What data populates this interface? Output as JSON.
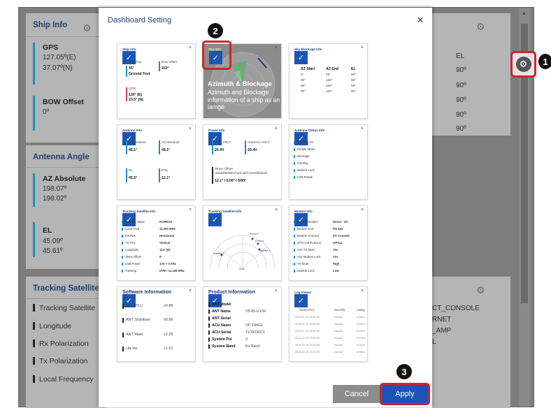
{
  "background": {
    "ship_info": {
      "title": "Ship Info",
      "gps_label": "GPS",
      "gps_lat": "127.05º(E)",
      "gps_lon": "37.07º(N)",
      "bow_label": "BOW Offset",
      "bow_value": "0º"
    },
    "antenna_angle": {
      "title": "Antenna Angle",
      "az_label": "AZ Absolute",
      "az_v1": "198.07º",
      "az_v2": "198.02º",
      "el_label": "EL",
      "el_v1": "45.09º",
      "el_v2": "45.61º"
    },
    "tracking": {
      "title": "Tracking Satellite",
      "items": [
        "Tracking Satellite",
        "Longitude",
        "Rx Polarization",
        "Tx Polarization",
        "Local Frequency"
      ]
    },
    "right_el": {
      "header": "EL",
      "values": [
        "90º",
        "90º",
        "90º",
        "90º",
        "90º"
      ]
    },
    "right_partial": [
      "CT_CONSOLE",
      "RNET",
      "_AMP",
      "L"
    ]
  },
  "callouts": {
    "c1": "1",
    "c2": "2",
    "c3": "3"
  },
  "modal": {
    "title": "Dashboard Setting",
    "close": "×",
    "cards": {
      "ship_info": {
        "title": "Ship Info",
        "items": [
          {
            "label": "Heading",
            "value": "45°",
            "sub": "Ground Test"
          },
          {
            "label": "Bow offset",
            "value": "163°"
          },
          {
            "label": "GPS",
            "value1": "120° (E)",
            "value2": "23.5° (N)"
          }
        ]
      },
      "azimuth": {
        "title": "Sky Info",
        "overlay_title": "Azimuth & Blockage",
        "overlay_text": "Azimuth and Blockage information of a ship as an iamge"
      },
      "blockage": {
        "title": "Sky Blockage Info",
        "headers": [
          "AZ Start",
          "AZ End",
          "EL"
        ],
        "rows": [
          [
            "0°",
            "20°",
            "90°"
          ],
          [
            "90°",
            "100°",
            "90°"
          ],
          [
            "90°",
            "100°",
            "90°"
          ],
          [
            "90°",
            "100°",
            "90°"
          ]
        ]
      },
      "antenna": {
        "title": "Antenna Info",
        "items": [
          {
            "label": "AZ Relative",
            "value": "45.1°"
          },
          {
            "label": "AZ Absolute",
            "value": "45.1°"
          },
          {
            "label": "EL",
            "value": "45.5°"
          },
          {
            "label": "POL",
            "value": "12.1°"
          }
        ]
      },
      "power": {
        "title": "Power Info",
        "items": [
          {
            "label": "ACU VOLT",
            "value": "26.9V"
          },
          {
            "label": "Antenna VOLT",
            "value": "20.4V"
          },
          {
            "label": "Skew Offset (Satellite/Mechanical/Consolidated)",
            "value": "12.1° / 0.00° / 0/00°"
          }
        ]
      },
      "status": {
        "title": "Antenna Status Info",
        "items": [
          "Tracking On",
          "Enable Mode",
          "Blockage",
          "Pointing",
          "Modem Lock",
          "LNB Rotate"
        ]
      },
      "tracking_sat": {
        "title": "Tracking Satellite Info",
        "rows": [
          [
            "Satellite Name",
            "KOREA5"
          ],
          [
            "Local Freq",
            "11,300 MHz"
          ],
          [
            "RX POL",
            "Horizontal"
          ],
          [
            "TX POL",
            "Vertical"
          ],
          [
            "Longitude",
            "113° (E)"
          ],
          [
            "Skew Offset",
            "0°"
          ],
          [
            "LNB Power",
            "13V + 0 kHz"
          ],
          [
            "Tracking",
            "DVB / 12,166 MHz"
          ]
        ]
      },
      "tracking_chart": {
        "title": "Tracking Satellite Info",
        "labels": [
          "Korea 5",
          "Korea 6",
          "Satellite A",
          "Satellite B"
        ],
        "center": "Ship"
      },
      "modem": {
        "title": "Modem Info",
        "rows": [
          [
            "Current Modem",
            "Direct - I/O"
          ],
          [
            "Modem Port",
            "RS 232"
          ],
          [
            "Modem Protocol",
            "I/O Console"
          ],
          [
            "GPS Out Protocol",
            "GPGLL"
          ],
          [
            "Use TX Mute",
            "Yes"
          ],
          [
            "Use Modem Lock",
            "Yes"
          ],
          [
            "TX Mute",
            "High"
          ],
          [
            "Modem Lock",
            "Low"
          ]
        ]
      },
      "software": {
        "title": "Software Information",
        "rows": [
          [
            "ACU PLU",
            "v0.89"
          ],
          [
            "ANT Stabilizer",
            "v0.86"
          ],
          [
            "ANT Main",
            "v2.29"
          ],
          [
            "Lib Ver",
            "v1.01"
          ]
        ]
      },
      "product": {
        "title": "Product Information",
        "rows": [
          [
            "ANT Model",
            ""
          ],
          [
            "ANT Name",
            "V5-85-U1/W"
          ],
          [
            "ANT Serial",
            ""
          ],
          [
            "ACU Name",
            "VP-T84G1"
          ],
          [
            "ACU Serial",
            "1V15030C1"
          ],
          [
            "System Pol",
            "3"
          ],
          [
            "System Band",
            "Ku Band"
          ]
        ]
      },
      "log": {
        "title": "Log Viewer",
        "headers": [
          "Time(UTC)",
          "Severity",
          "Categ"
        ],
        "rows": [
          [
            "2018-01-19 00:02:00",
            "Normal",
            "Antenn"
          ],
          [
            "2018-01-19 00:02:00",
            "Normal",
            "Antenn"
          ],
          [
            "2018-01-19 00:02:00",
            "Normal",
            "Antenn"
          ],
          [
            "2018-01-19 00:02:00",
            "Normal",
            "Antenn"
          ],
          [
            "2018-01-19 00:02:00",
            "Normal",
            "Antenn"
          ],
          [
            "2018-01-19 00:02:00",
            "Normal",
            "Antenn"
          ]
        ]
      }
    },
    "cancel_label": "Cancel",
    "apply_label": "Apply"
  }
}
